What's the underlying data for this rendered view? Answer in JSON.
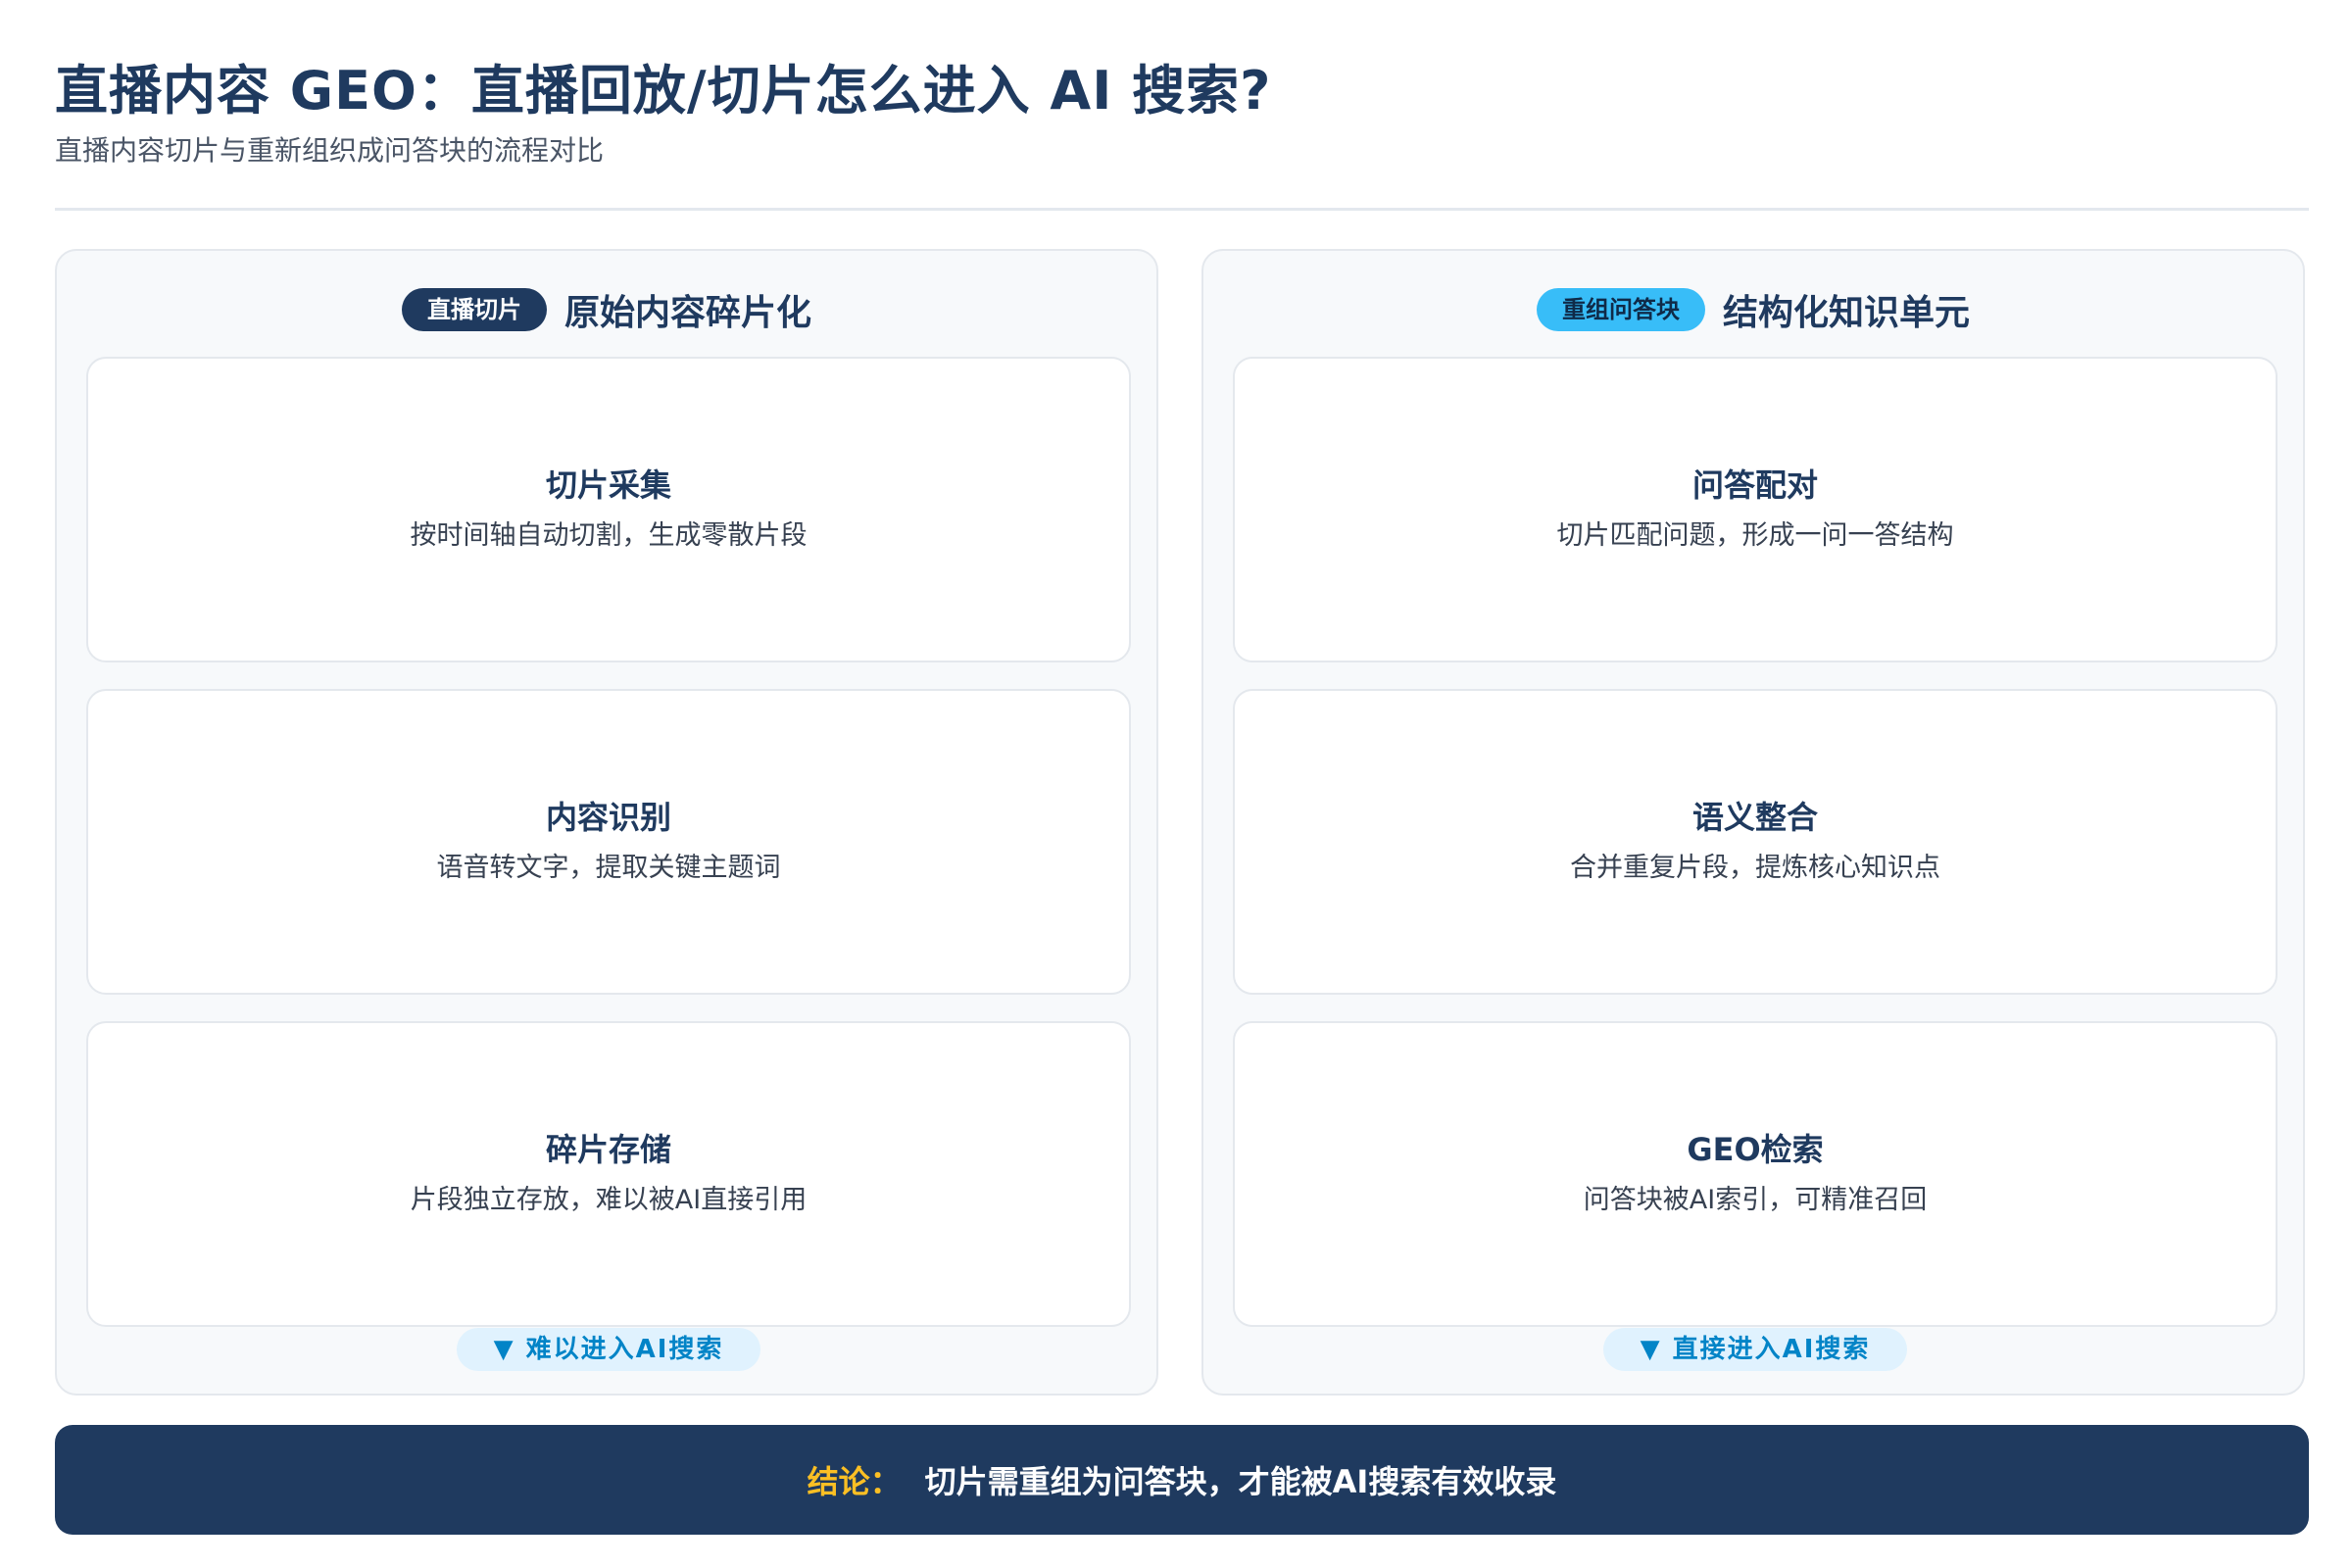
{
  "header": {
    "title": "直播内容 GEO：直播回放/切片怎么进入 AI 搜索?",
    "subtitle": "直播内容切片与重新组织成问答块的流程对比"
  },
  "left_panel": {
    "badge": "直播切片",
    "title": "原始内容碎片化",
    "cards": [
      {
        "title": "切片采集",
        "desc": "按时间轴自动切割，生成零散片段"
      },
      {
        "title": "内容识别",
        "desc": "语音转文字，提取关键主题词"
      },
      {
        "title": "碎片存储",
        "desc": "片段独立存放，难以被AI直接引用"
      }
    ],
    "flow_tag": "▼ 难以进入AI搜索"
  },
  "right_panel": {
    "badge": "重组问答块",
    "title": "结构化知识单元",
    "cards": [
      {
        "title": "问答配对",
        "desc": "切片匹配问题，形成一问一答结构"
      },
      {
        "title": "语义整合",
        "desc": "合并重复片段，提炼核心知识点"
      },
      {
        "title": "GEO检索",
        "desc": "问答块被AI索引，可精准召回"
      }
    ],
    "flow_tag": "▼ 直接进入AI搜索"
  },
  "conclusion": {
    "label": "结论：",
    "text": "切片需重组为问答块，才能被AI搜索有效收录"
  },
  "colors": {
    "primary": "#1f3a5f",
    "accent": "#38bdf8",
    "highlight": "#fbbf24",
    "flow_tag": "#0284c7"
  }
}
